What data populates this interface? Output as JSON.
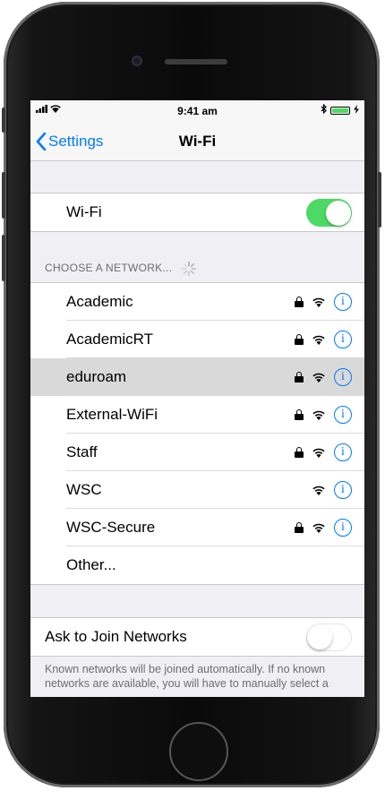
{
  "status_bar": {
    "time": "9:41 am",
    "signal": "▐▐▐",
    "bluetooth": "✱",
    "charging": "⚡"
  },
  "nav": {
    "back_label": "Settings",
    "title": "Wi-Fi"
  },
  "wifi_row": {
    "label": "Wi-Fi",
    "enabled": true
  },
  "networks_header": "CHOOSE A NETWORK...",
  "networks": [
    {
      "name": "Academic",
      "locked": true
    },
    {
      "name": "AcademicRT",
      "locked": true
    },
    {
      "name": "eduroam",
      "locked": true
    },
    {
      "name": "External-WiFi",
      "locked": true
    },
    {
      "name": "Staff",
      "locked": true
    },
    {
      "name": "WSC",
      "locked": false
    },
    {
      "name": "WSC-Secure",
      "locked": true
    }
  ],
  "other_label": "Other...",
  "ask_to_join": {
    "label": "Ask to Join Networks",
    "enabled": false
  },
  "footer_text": "Known networks will be joined automatically. If no known networks are available, you will have to manually select a",
  "info_glyph": "i",
  "colors": {
    "accent": "#007aff",
    "toggle_on": "#4cd964",
    "highlight_row": "#d9d9d9"
  }
}
